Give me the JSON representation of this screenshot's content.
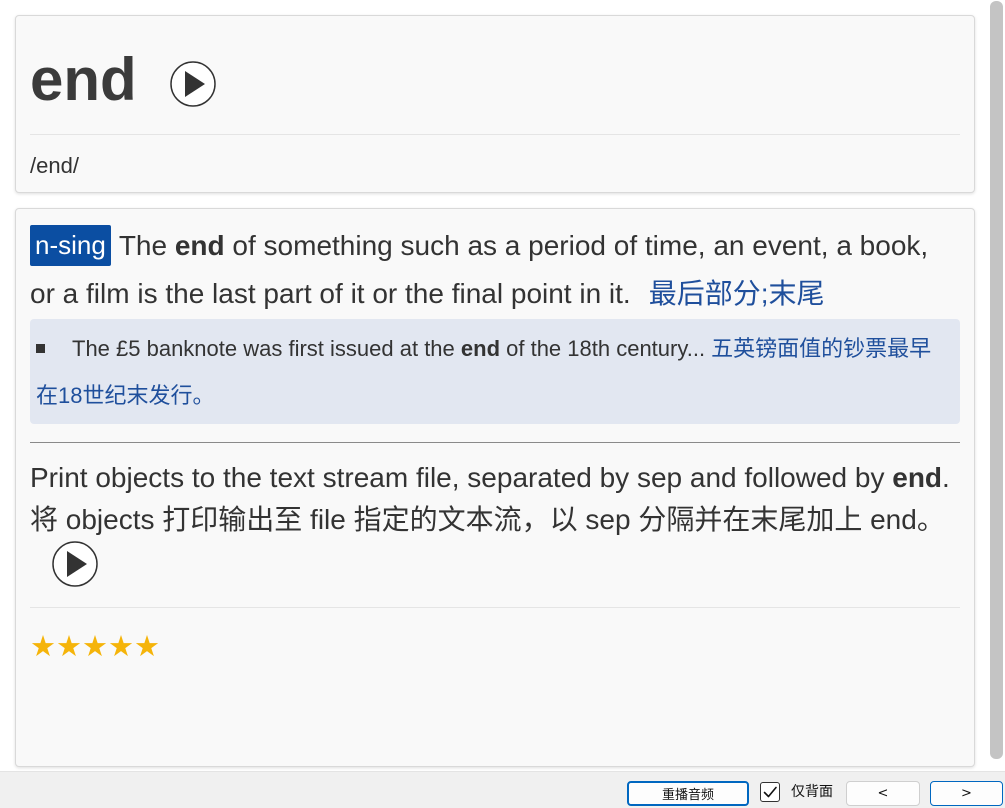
{
  "front": {
    "word": "end",
    "audio_icon": "play-icon",
    "phonetic": "/end/"
  },
  "sense": {
    "pos_badge": "n-sing",
    "definition_before": "The ",
    "definition_bold": "end",
    "definition_after": " of something such as a period of time, an event, a book, or a film is the last part of it or the final point in it.",
    "definition_zh": "最后部分;末尾",
    "example": {
      "bullet_icon": "square-bullet-icon",
      "before": "The £5 banknote was first issued at the ",
      "bold": "end",
      "after": " of the 18th century...",
      "zh": "五英镑面值的钞票最早在18世纪末发行。"
    }
  },
  "usage": {
    "en_before": "Print objects to the text stream file, separated by sep and followed by ",
    "en_bold": "end",
    "en_after": ".",
    "zh": "将 objects 打印输出至 file 指定的文本流，以 sep 分隔并在末尾加上 end。",
    "audio_icon": "play-icon"
  },
  "rating": {
    "value": 5,
    "max": 5,
    "icon": "star-icon"
  },
  "toolbar": {
    "replay_label": "重播音频",
    "back_only_label": "仅背面",
    "back_only_checked": true,
    "prev_label": "<",
    "next_label": ">"
  },
  "colors": {
    "pos_badge_bg": "#0b4ea2",
    "translation": "#1f4f9c",
    "example_bg": "#e2e7f1",
    "star": "#f5b40a",
    "focus_border": "#0067c0"
  }
}
